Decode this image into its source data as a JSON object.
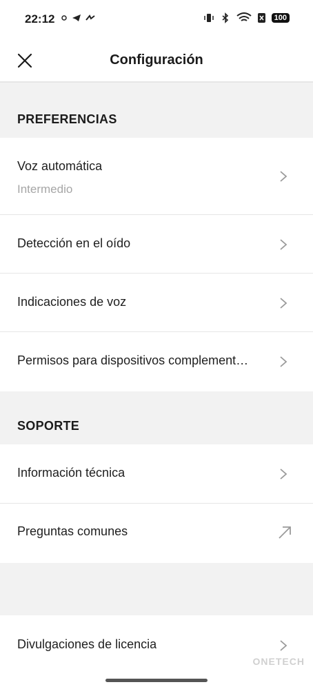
{
  "status_bar": {
    "time": "22:12",
    "battery": "100",
    "icons_left": [
      "signal-dot-icon",
      "telegram-icon",
      "sync-icon"
    ],
    "icons_right": [
      "vibrate-icon",
      "bluetooth-icon",
      "wifi-icon",
      "sim-off-icon",
      "battery-icon"
    ]
  },
  "header": {
    "title": "Configuración",
    "close_icon": "close-icon"
  },
  "sections": {
    "preferencias": {
      "title": "PREFERENCIAS",
      "items": [
        {
          "label": "Voz automática",
          "value": "Intermedio",
          "icon": "chevron-right-icon"
        },
        {
          "label": "Detección en el oído",
          "icon": "chevron-right-icon"
        },
        {
          "label": "Indicaciones de voz",
          "icon": "chevron-right-icon"
        },
        {
          "label": "Permisos para dispositivos complement…",
          "icon": "chevron-right-icon"
        }
      ]
    },
    "soporte": {
      "title": "SOPORTE",
      "items": [
        {
          "label": "Información técnica",
          "icon": "chevron-right-icon"
        },
        {
          "label": "Preguntas comunes",
          "icon": "external-link-icon"
        }
      ]
    },
    "other": {
      "items": [
        {
          "label": "Divulgaciones de licencia",
          "icon": "chevron-right-icon"
        }
      ]
    }
  },
  "watermark": "ONETECH"
}
